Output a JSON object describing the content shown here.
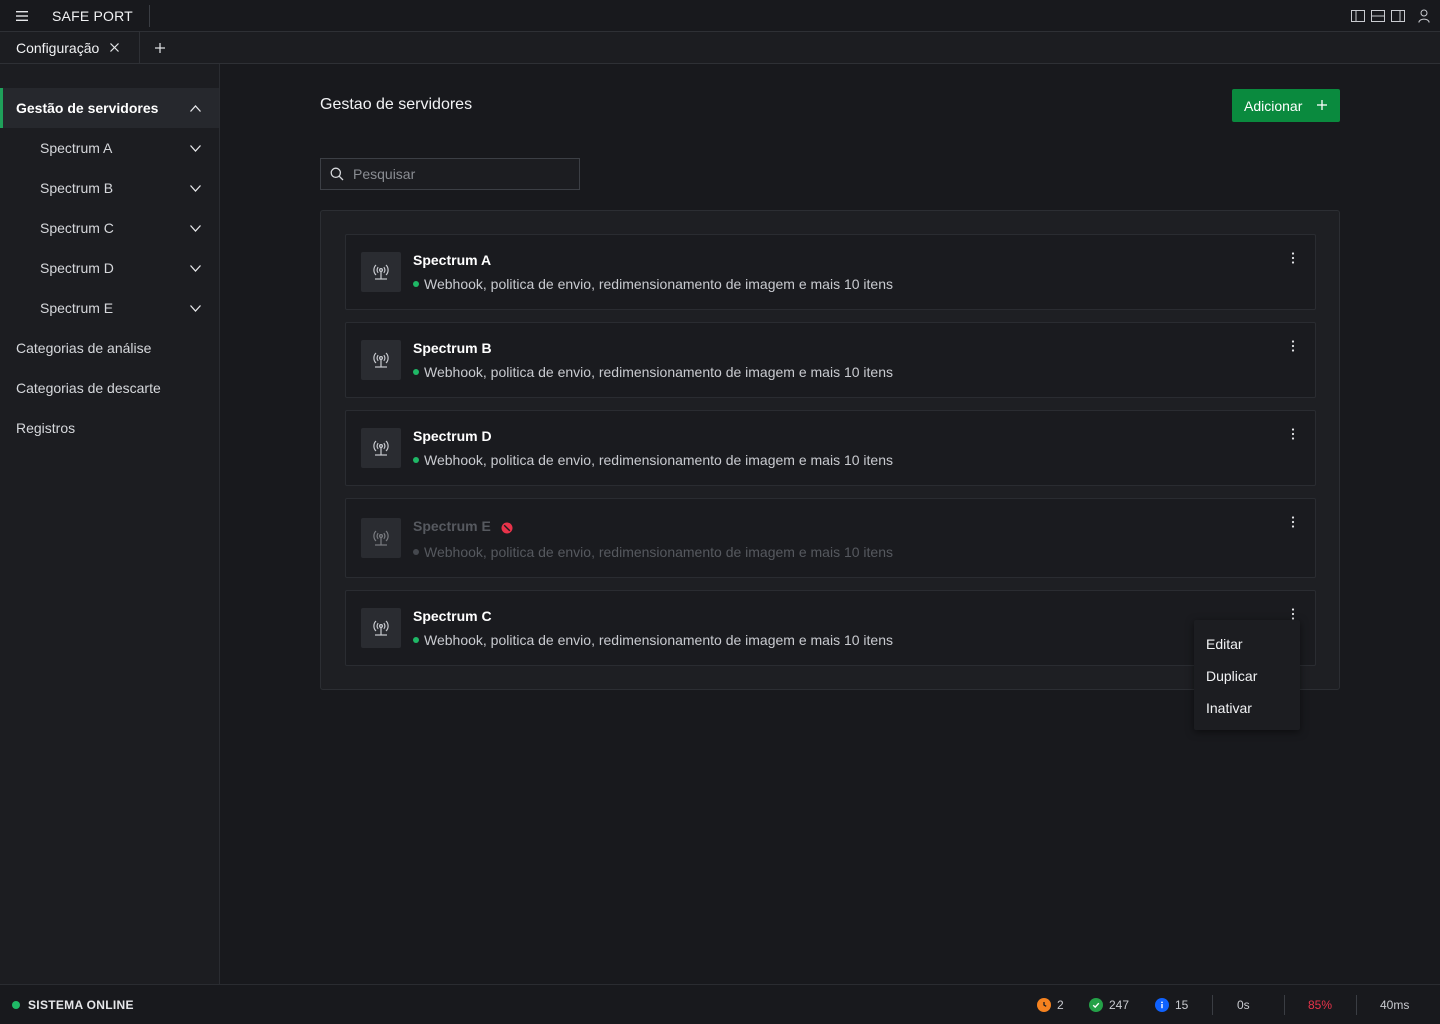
{
  "app": {
    "title": "SAFE PORT"
  },
  "tabs": [
    {
      "label": "Configuração"
    }
  ],
  "sidebar": {
    "items": [
      {
        "label": "Gestão de servidores"
      },
      {
        "label": "Spectrum A"
      },
      {
        "label": "Spectrum B"
      },
      {
        "label": "Spectrum C"
      },
      {
        "label": "Spectrum D"
      },
      {
        "label": "Spectrum E"
      },
      {
        "label": "Categorias de análise"
      },
      {
        "label": "Categorias de descarte"
      },
      {
        "label": "Registros"
      }
    ]
  },
  "main": {
    "title": "Gestao de servidores",
    "add_label": "Adicionar",
    "search_placeholder": "Pesquisar"
  },
  "servers": [
    {
      "name": "Spectrum A",
      "description": "Webhook, politica de envio, redimensionamento de imagem e mais 10 itens",
      "status": "active"
    },
    {
      "name": "Spectrum B",
      "description": "Webhook, politica de envio, redimensionamento de imagem e mais 10 itens",
      "status": "active"
    },
    {
      "name": "Spectrum D",
      "description": "Webhook, politica de envio, redimensionamento de imagem e mais 10 itens",
      "status": "active"
    },
    {
      "name": "Spectrum E",
      "description": "Webhook, politica de envio, redimensionamento de imagem e mais 10 itens",
      "status": "inactive"
    },
    {
      "name": "Spectrum C",
      "description": "Webhook, politica de envio, redimensionamento de imagem e mais 10 itens",
      "status": "active"
    }
  ],
  "context_menu": {
    "items": [
      "Editar",
      "Duplicar",
      "Inativar"
    ]
  },
  "statusbar": {
    "online_label": "SISTEMA ONLINE",
    "warnings": "2",
    "success": "247",
    "info": "15",
    "time": "0s",
    "percent": "85%",
    "latency": "40ms"
  },
  "colors": {
    "accent": "#0a8a3e",
    "online": "#1fb866",
    "warning": "#f5821f",
    "success": "#24a148",
    "info": "#0f62fe",
    "danger": "#e8334a"
  }
}
